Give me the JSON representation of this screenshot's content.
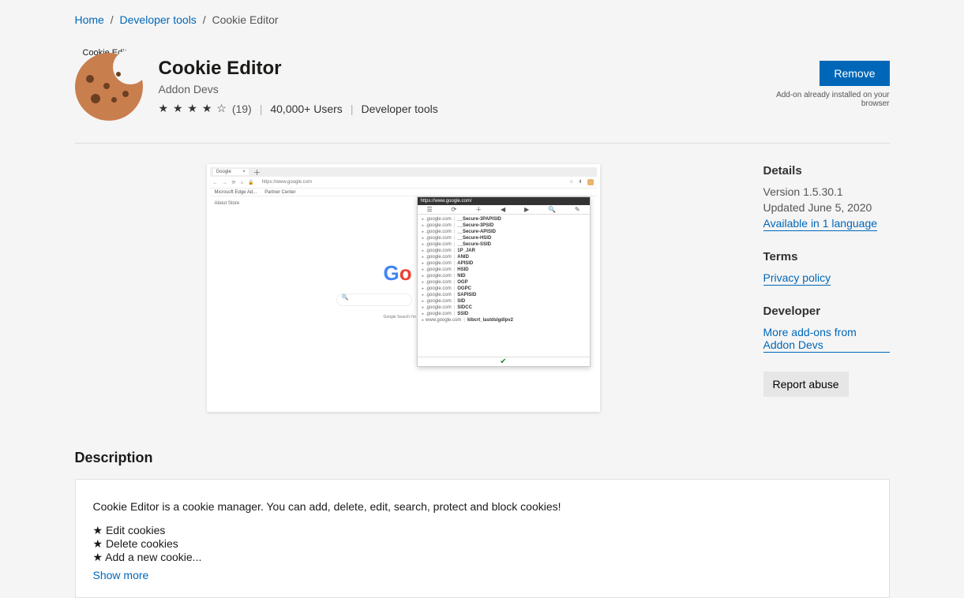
{
  "breadcrumb": {
    "home": "Home",
    "cat": "Developer tools",
    "current": "Cookie Editor"
  },
  "header": {
    "title": "Cookie Editor",
    "author": "Addon Devs",
    "icon_caption": "Cookie Editor",
    "rating_count": "(19)",
    "users": "40,000+ Users",
    "category": "Developer tools"
  },
  "action": {
    "remove": "Remove",
    "installed": "Add-on already installed on your browser"
  },
  "preview": {
    "tab": "Google",
    "url": "https://www.google.com",
    "bookmarks": [
      "Microsoft Edge Ad...",
      "Partner Center"
    ],
    "nav_links": "About    Store",
    "search_btns": "Google Search      I'm Feeling Lucky",
    "popup_title": "https://www.google.com/",
    "tool_icons": [
      "☰",
      "⟳",
      "＋",
      "◀",
      "▶",
      "🔍",
      "✎"
    ],
    "cookies": [
      {
        "d": ".google.com",
        "n": "__Secure-3PAPISID"
      },
      {
        "d": ".google.com",
        "n": "__Secure-3PSID"
      },
      {
        "d": ".google.com",
        "n": "__Secure-APISID"
      },
      {
        "d": ".google.com",
        "n": "__Secure-HSID"
      },
      {
        "d": ".google.com",
        "n": "__Secure-SSID"
      },
      {
        "d": ".google.com",
        "n": "1P_JAR"
      },
      {
        "d": ".google.com",
        "n": "ANID"
      },
      {
        "d": ".google.com",
        "n": "APISID"
      },
      {
        "d": ".google.com",
        "n": "HSID"
      },
      {
        "d": ".google.com",
        "n": "NID"
      },
      {
        "d": ".google.com",
        "n": "OGP"
      },
      {
        "d": ".google.com",
        "n": "OGPC"
      },
      {
        "d": ".google.com",
        "n": "SAPISID"
      },
      {
        "d": ".google.com",
        "n": "SID"
      },
      {
        "d": ".google.com",
        "n": "SIDCC"
      },
      {
        "d": ".google.com",
        "n": "SSID"
      },
      {
        "d": "www.google.com",
        "n": "klbcrt_lastdslgdlpv2"
      }
    ]
  },
  "details": {
    "heading": "Details",
    "version": "Version 1.5.30.1",
    "updated": "Updated June 5, 2020",
    "language": "Available in 1 language"
  },
  "terms": {
    "heading": "Terms",
    "privacy": "Privacy policy"
  },
  "developer": {
    "heading": "Developer",
    "more": "More add-ons from Addon Devs"
  },
  "report": "Report abuse",
  "description": {
    "heading": "Description",
    "intro": "Cookie Editor is a cookie manager. You can add, delete, edit, search, protect and block cookies!",
    "l1": "★ Edit cookies",
    "l2": "★ Delete cookies",
    "l3": "★ Add a new cookie...",
    "show_more": "Show more"
  }
}
